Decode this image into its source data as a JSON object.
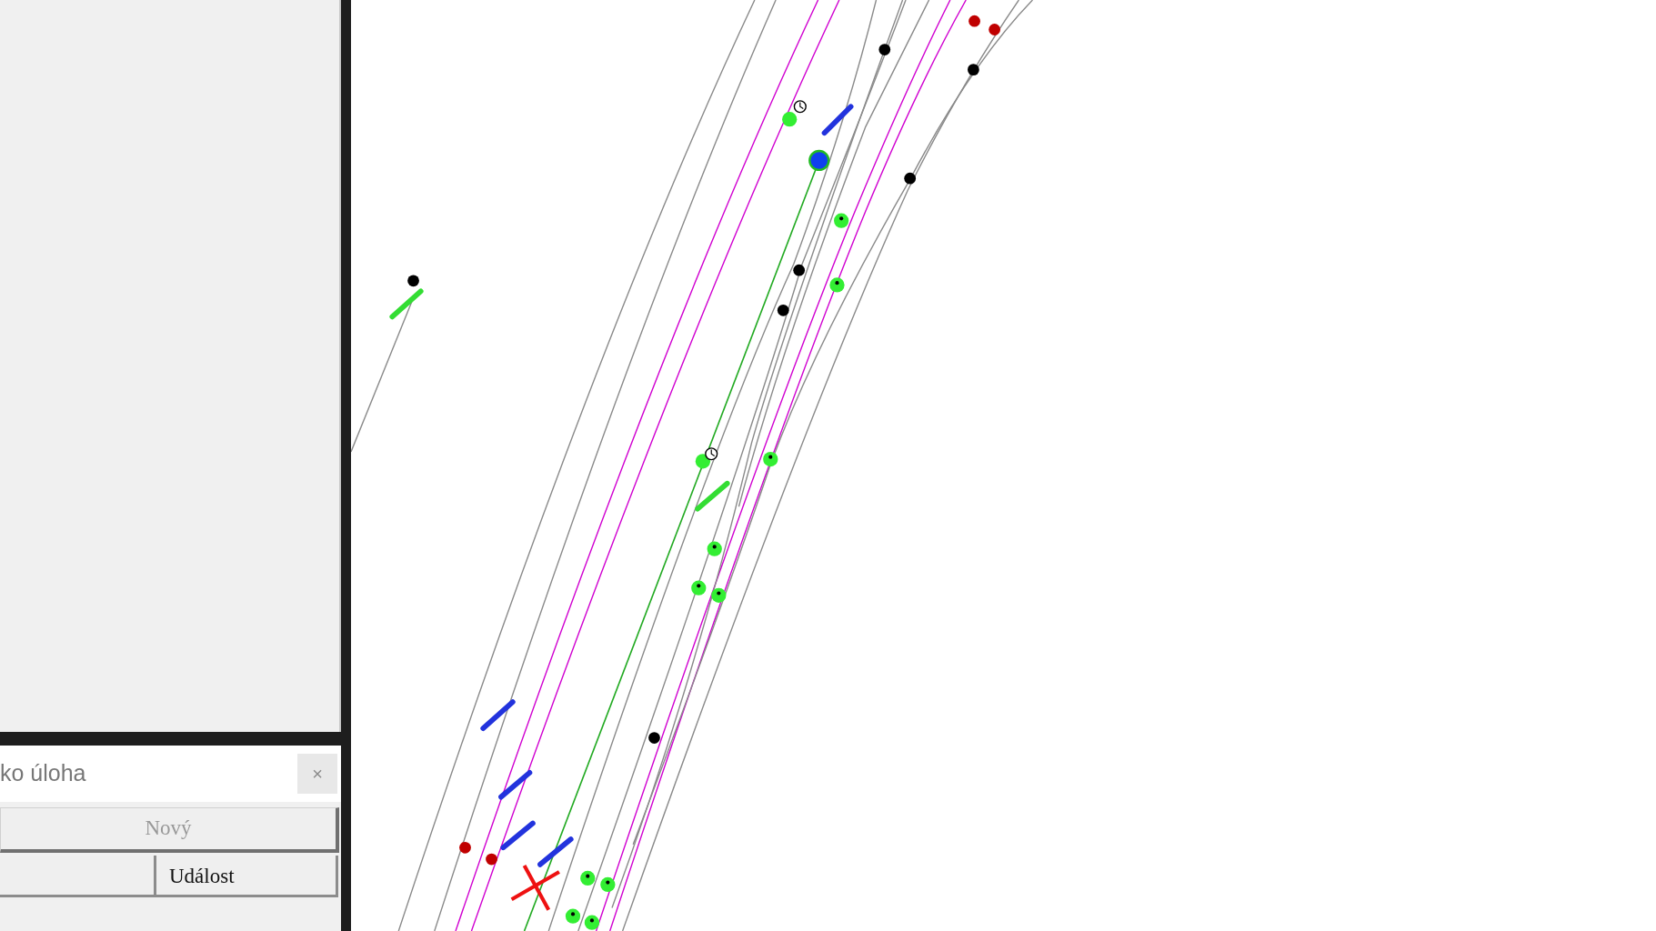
{
  "task_panel": {
    "title": "ko úloha",
    "close": "×",
    "new_button": {
      "label": "Nový",
      "disabled": true
    },
    "columns": [
      {
        "label": "Událost"
      }
    ]
  }
}
